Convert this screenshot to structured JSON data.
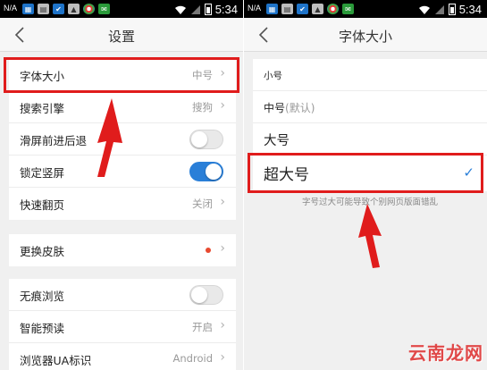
{
  "status_bar": {
    "carrier": "N/A",
    "time": "5:34"
  },
  "left_screen": {
    "title": "设置",
    "back_icon": "chevron-left-icon",
    "rows": [
      {
        "label": "字体大小",
        "value": "中号",
        "control": "chevron"
      },
      {
        "label": "搜索引擎",
        "value": "搜狗",
        "control": "chevron"
      },
      {
        "label": "滑屏前进后退",
        "value": "",
        "control": "toggle",
        "state": "off"
      },
      {
        "label": "锁定竖屏",
        "value": "",
        "control": "toggle",
        "state": "on"
      },
      {
        "label": "快速翻页",
        "value": "关闭",
        "control": "chevron"
      },
      {
        "label": "更换皮肤",
        "value": "",
        "control": "dot-chevron"
      },
      {
        "label": "无痕浏览",
        "value": "",
        "control": "toggle",
        "state": "off"
      },
      {
        "label": "智能预读",
        "value": "开启",
        "control": "chevron"
      },
      {
        "label": "浏览器UA标识",
        "value": "Android",
        "control": "chevron"
      }
    ]
  },
  "right_screen": {
    "title": "字体大小",
    "back_icon": "chevron-left-icon",
    "options": [
      {
        "label": "小号",
        "selected": false
      },
      {
        "label": "中号",
        "suffix": "(默认)",
        "selected": false
      },
      {
        "label": "大号",
        "selected": false
      },
      {
        "label": "超大号",
        "selected": true
      }
    ],
    "hint": "字号过大可能导致个别网页版面错乱"
  },
  "watermark": "云南龙网",
  "colors": {
    "accent_blue": "#2a7fd8",
    "highlight_red": "#e01c1c",
    "background": "#f0f0f0",
    "toggle_off": "#e9e9e9"
  }
}
